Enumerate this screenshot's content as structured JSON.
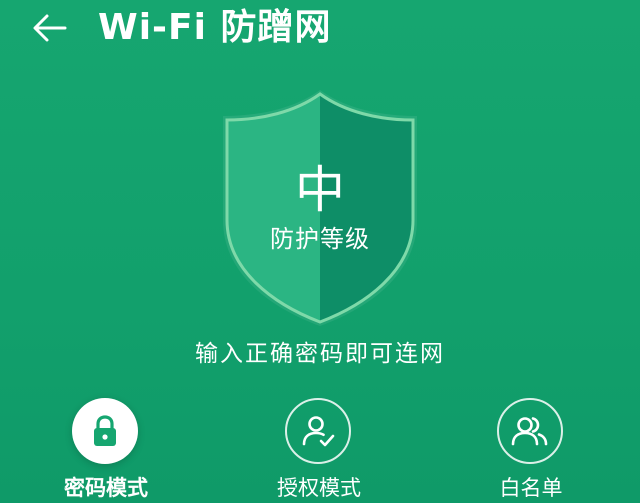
{
  "header": {
    "title": "Wi-Fi 防蹭网"
  },
  "shield": {
    "level": "中",
    "caption": "防护等级"
  },
  "status": {
    "text": "输入正确密码即可连网"
  },
  "modes": [
    {
      "label": "密码模式",
      "icon": "lock-icon",
      "active": true
    },
    {
      "label": "授权模式",
      "icon": "user-check-icon",
      "active": false
    },
    {
      "label": "白名单",
      "icon": "users-icon",
      "active": false
    }
  ],
  "colors": {
    "background": "#16a670",
    "shield_light": "#2bb583",
    "shield_dark": "#0e8e67",
    "shield_outline": "#7ed9a9",
    "active_icon": "#16a670"
  }
}
